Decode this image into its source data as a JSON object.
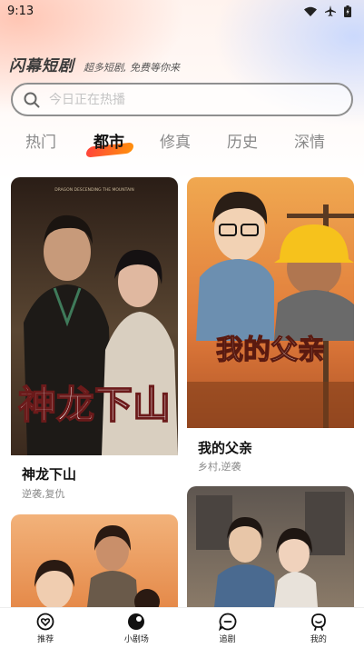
{
  "status": {
    "time": "9:13"
  },
  "brand": {
    "name": "闪幕短剧",
    "slogan": "超多短剧, 免费等你来"
  },
  "search": {
    "placeholder": "今日正在热播"
  },
  "tabs": [
    {
      "label": "热门"
    },
    {
      "label": "都市"
    },
    {
      "label": "修真"
    },
    {
      "label": "历史"
    },
    {
      "label": "深情"
    }
  ],
  "active_tab": "都市",
  "cards": [
    {
      "title": "神龙下山",
      "tags": "逆袭,复仇",
      "poster_text": "神龙下山",
      "poster_subtitle": "DRAGON DESCENDING THE MOUNTAIN"
    },
    {
      "title": "我的父亲",
      "tags": "乡村,逆袭",
      "poster_text": "我的父亲"
    }
  ],
  "nav": [
    {
      "label": "推荐",
      "icon": "heart-chat-icon"
    },
    {
      "label": "小剧场",
      "icon": "theater-icon"
    },
    {
      "label": "追剧",
      "icon": "chat-bubble-icon"
    },
    {
      "label": "我的",
      "icon": "profile-icon"
    }
  ],
  "colors": {
    "accent_start": "#ff3b30",
    "accent_end": "#ff8a00"
  }
}
